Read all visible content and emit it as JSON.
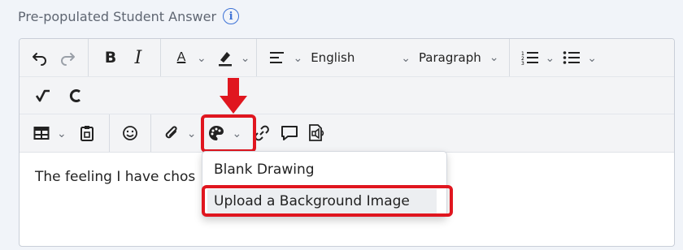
{
  "field": {
    "label": "Pre-populated Student Answer",
    "info_glyph": "i"
  },
  "toolbar": {
    "language": "English",
    "block_format": "Paragraph",
    "font_color_glyph": "A",
    "bold_glyph": "B",
    "italic_glyph": "I"
  },
  "editor": {
    "text": "The feeling I have chos"
  },
  "dropdown": {
    "items": [
      "Blank Drawing",
      "Upload a Background Image"
    ]
  },
  "colors": {
    "highlight": "#e0161f",
    "info": "#3d72d6"
  }
}
